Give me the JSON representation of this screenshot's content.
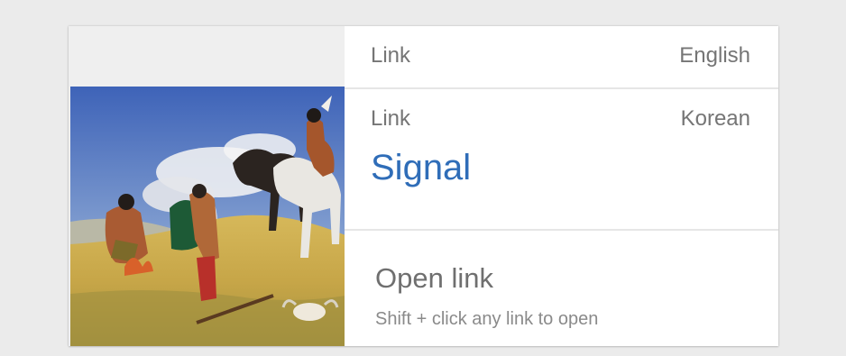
{
  "entries": {
    "english": {
      "label": "Link",
      "language": "English"
    },
    "korean": {
      "label": "Link",
      "language": "Korean",
      "word": "Signal"
    }
  },
  "open": {
    "title": "Open link",
    "hint": "Shift + click any link to open"
  },
  "colors": {
    "link_word": "#2f6db8",
    "label_text": "#757575",
    "page_background": "#ebebeb"
  }
}
